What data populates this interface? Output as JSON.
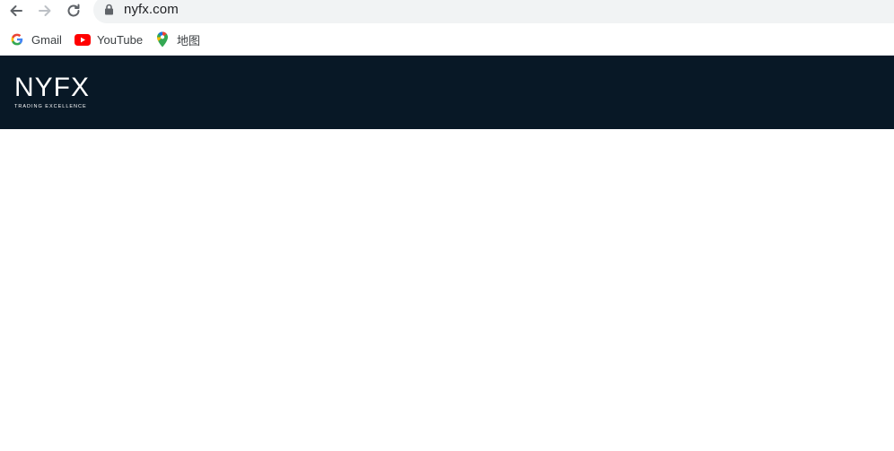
{
  "browser": {
    "url": "nyfx.com",
    "bookmarks": [
      {
        "label": "Gmail",
        "icon": "google-g-icon"
      },
      {
        "label": "YouTube",
        "icon": "youtube-icon"
      },
      {
        "label": "地图",
        "icon": "maps-pin-icon"
      }
    ]
  },
  "site": {
    "logo_word": "NYFX",
    "logo_tagline": "TRADING EXCELLENCE",
    "header_color": "#081826"
  }
}
